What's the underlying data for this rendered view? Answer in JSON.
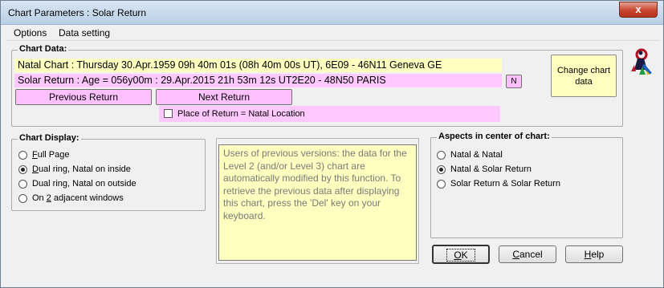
{
  "window": {
    "title": "Chart Parameters : Solar Return",
    "close_label": "x"
  },
  "menu": {
    "items": [
      "Options",
      "Data setting"
    ]
  },
  "chart_data_group": {
    "label": "Chart Data:",
    "natal_line": "Natal Chart : Thursday 30.Apr.1959 09h 40m 01s (08h 40m 00s UT), 6E09 - 46N11  Geneva GE",
    "solar_line": "Solar Return : Age = 056y00m : 29.Apr.2015 21h 53m 12s UT2E20 - 48N50  PARIS",
    "n_button": "N",
    "previous_button": "Previous Return",
    "next_button": "Next Return",
    "place_checkbox_label": "Place of Return = Natal Location",
    "place_checked": false,
    "change_button": "Change chart data"
  },
  "chart_display": {
    "label": "Chart Display:",
    "options": [
      {
        "pre": "",
        "key": "F",
        "post": "ull Page",
        "checked": false
      },
      {
        "pre": "",
        "key": "D",
        "post": "ual ring, Natal on inside",
        "checked": true
      },
      {
        "pre": "Dual ring, Natal on outside",
        "key": "",
        "post": "",
        "checked": false
      },
      {
        "pre": "On ",
        "key": "2",
        "post": " adjacent windows",
        "checked": false
      }
    ]
  },
  "info_text": "Users of previous versions: the data for the Level 2 (and/or Level 3) chart are automatically modified by this function. To retrieve the previous data after displaying this chart, press the 'Del' key on your keyboard.",
  "aspects": {
    "label": "Aspects in center of chart:",
    "options": [
      {
        "text": "Natal & Natal",
        "checked": false
      },
      {
        "text": "Natal & Solar Return",
        "checked": true
      },
      {
        "text": "Solar Return & Solar Return",
        "checked": false
      }
    ]
  },
  "buttons": {
    "ok": {
      "key": "O",
      "rest": "K"
    },
    "cancel": {
      "key": "C",
      "rest": "ancel"
    },
    "help": {
      "key": "H",
      "rest": "elp"
    }
  },
  "icon": "astrology-figure-icon"
}
